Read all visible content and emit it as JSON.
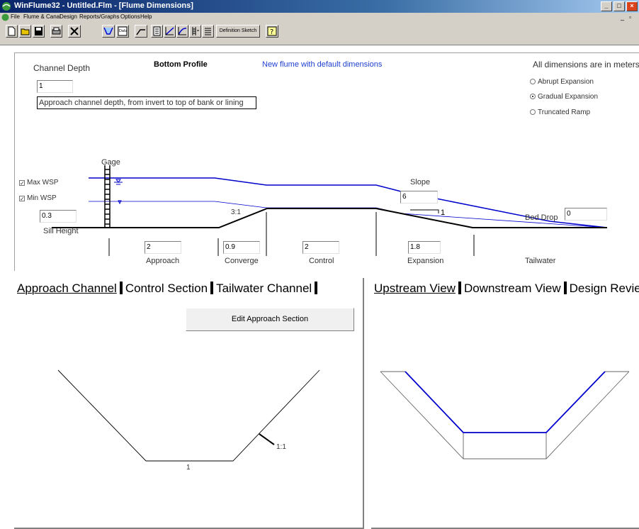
{
  "window": {
    "title": "WinFlume32 - Untitled.Flm - [Flume Dimensions]"
  },
  "menu": {
    "items": [
      "File",
      "Flume & Canal",
      "Design",
      "Reports/Graphs",
      "Options",
      "Help"
    ]
  },
  "toolbar": {
    "definition_sketch_label": "Definition Sketch",
    "data_icon_label": "Data"
  },
  "dimensions": {
    "channel_depth_label": "Channel Depth",
    "channel_depth_value": "1",
    "tooltip": "Approach channel depth, from invert to top of bank or lining",
    "bottom_profile_label": "Bottom Profile",
    "status_message": "New flume with default dimensions",
    "units_note": "All dimensions are in meters",
    "expansion_options": [
      {
        "label": "Abrupt Expansion",
        "selected": false
      },
      {
        "label": "Gradual Expansion",
        "selected": true
      },
      {
        "label": "Truncated Ramp",
        "selected": false
      }
    ],
    "gage_label": "Gage",
    "max_wsp_label": "Max WSP",
    "max_wsp_checked": true,
    "min_wsp_label": "Min WSP",
    "min_wsp_checked": true,
    "sill_height_label": "Sill Height",
    "sill_height_value": "0.3",
    "converge_ratio_label": "3:1",
    "slope_label": "Slope",
    "slope_value": "6",
    "slope_ratio_label": "1",
    "bed_drop_label": "Bed Drop",
    "bed_drop_value": "0",
    "sections": [
      {
        "label": "Approach",
        "value": "2"
      },
      {
        "label": "Converge",
        "value": "0.9"
      },
      {
        "label": "Control",
        "value": "2"
      },
      {
        "label": "Expansion",
        "value": "1.8"
      },
      {
        "label": "Tailwater",
        "value": ""
      }
    ]
  },
  "left_panel": {
    "tabs": [
      "Approach Channel",
      "Control Section",
      "Tailwater Channel"
    ],
    "edit_button": "Edit Approach Section",
    "bottom_width_label": "1",
    "side_slope_label": "1:1"
  },
  "right_panel": {
    "tabs": [
      "Upstream View",
      "Downstream View",
      "Design Review"
    ]
  },
  "colors": {
    "titlebar_start": "#0a246a",
    "water_line": "#0000cc",
    "status_text": "#1f3fcf",
    "panel_bg": "#ffffff",
    "chrome": "#d4d0c8"
  }
}
